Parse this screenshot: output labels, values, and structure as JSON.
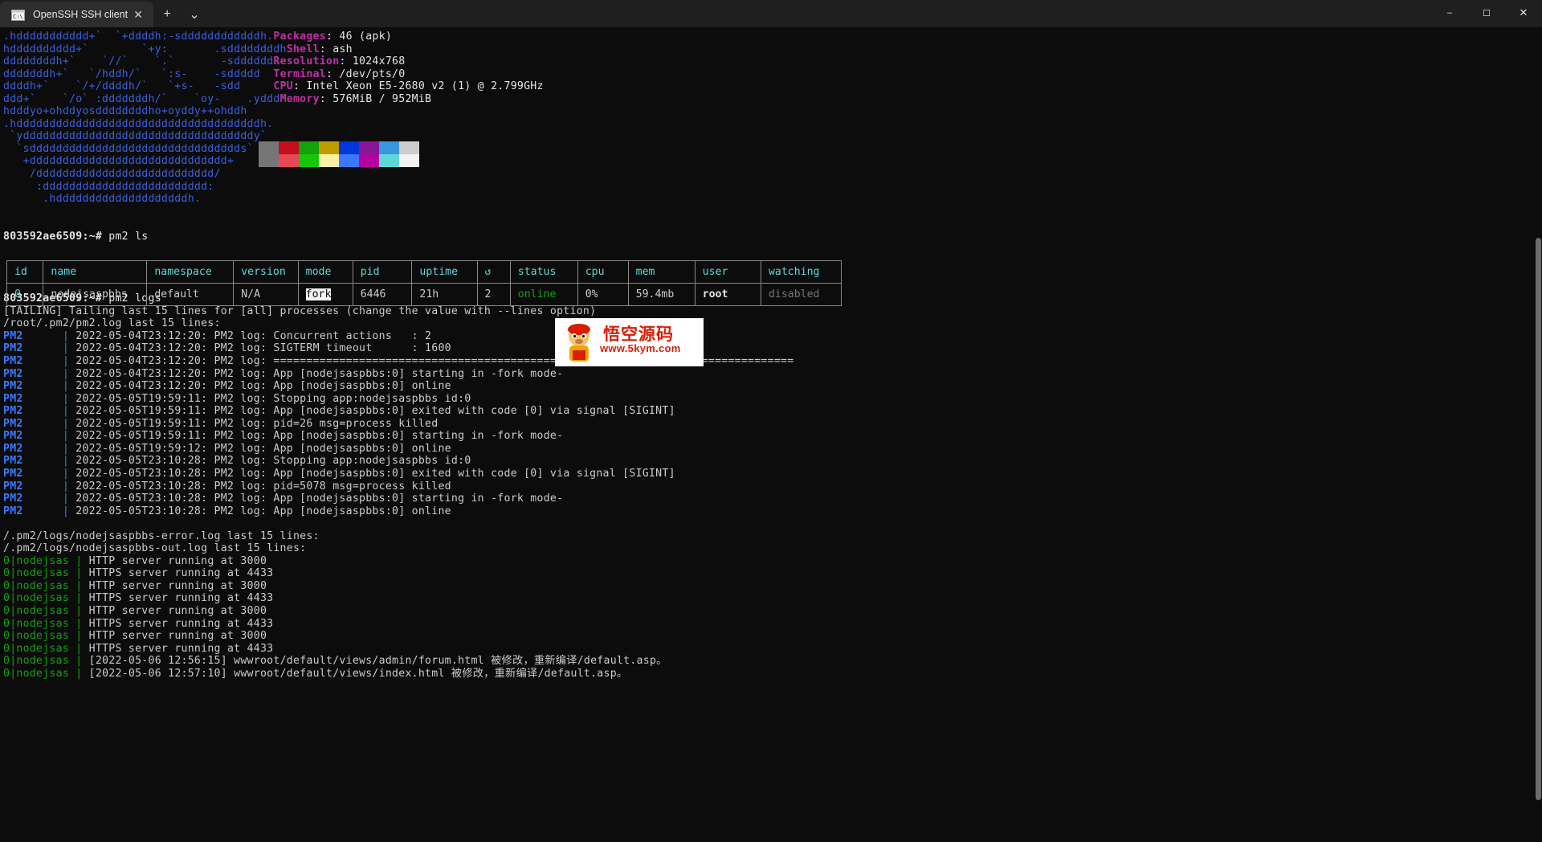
{
  "window": {
    "tab_title": "OpenSSH SSH client",
    "tab_icon": "terminal-icon",
    "close_glyph": "✕",
    "new_tab_glyph": "+",
    "dropdown_glyph": "⌄",
    "minimize_glyph": "–",
    "maximize_glyph": "☐",
    "window_close_glyph": "✕"
  },
  "neofetch": {
    "ascii": [
      ".hddddddddddd+`  `+ddddh:-sddddddddddddh.",
      "hdddddddddd+`        `+y:       .sddddddddh",
      "ddddddddh+`    `//`    `.`       -sdddddd",
      "dddddddh+`   `/hddh/`   `:s-    -sddddd",
      "ddddh+`    `/+/ddddh/`   `+s-   -sdd",
      "ddd+`    `/o` :dddddddh/`    `oy-    .yddd",
      "hdddyo+ohddyosddddddddho+oyddy++ohddh",
      ".hdddddddddddddddddddddddddddddddddddddh.",
      " `ydddddddddddddddddddddddddddddddddddy`",
      "  `sdddddddddddddddddddddddddddddddds`",
      "   +dddddddddddddddddddddddddddddd+",
      "    /ddddddddddddddddddddddddddd/",
      "     :ddddddddddddddddddddddddd:",
      "      .hddddddddddddddddddddh."
    ],
    "info": [
      {
        "label": "Packages",
        "value": "46 (apk)"
      },
      {
        "label": "Shell",
        "value": "ash"
      },
      {
        "label": "Resolution",
        "value": "1024x768"
      },
      {
        "label": "Terminal",
        "value": "/dev/pts/0"
      },
      {
        "label": "CPU",
        "value": "Intel Xeon E5-2680 v2 (1) @ 2.799GHz"
      },
      {
        "label": "Memory",
        "value": "576MiB / 952MiB"
      }
    ],
    "palette_row1": [
      "#767676",
      "#c50f1f",
      "#13a10e",
      "#c19c00",
      "#0037da",
      "#881798",
      "#3a96dd",
      "#cccccc"
    ],
    "palette_row2": [
      "#767676",
      "#e74856",
      "#16c60c",
      "#f9f1a5",
      "#3b78ff",
      "#b4009e",
      "#61d6d6",
      "#f2f2f2"
    ]
  },
  "prompt": "803592ae6509:~#",
  "commands": {
    "ls": "pm2 ls",
    "logs": "pm2 logs"
  },
  "pm2_table": {
    "headers": [
      "id",
      "name",
      "namespace",
      "version",
      "mode",
      "pid",
      "uptime",
      "↺",
      "status",
      "cpu",
      "mem",
      "user",
      "watching"
    ],
    "row": {
      "id": "0",
      "name": "nodejsaspbbs",
      "namespace": "default",
      "version": "N/A",
      "mode": "fork",
      "pid": "6446",
      "uptime": "21h",
      "restarts": "2",
      "status": "online",
      "cpu": "0%",
      "mem": "59.4mb",
      "user": "root",
      "watching": "disabled"
    }
  },
  "logs": {
    "tailing_notice": "[TAILING] Tailing last 15 lines for [all] processes (change the value with --lines option)",
    "pm2_log_header": "/root/.pm2/pm2.log last 15 lines:",
    "error_log_header": "/.pm2/logs/nodejsaspbbs-error.log last 15 lines:",
    "out_log_header": "/.pm2/logs/nodejsaspbbs-out.log last 15 lines:",
    "pm2_prefix": "PM2",
    "pm2_lines": [
      "2022-05-04T23:12:20: PM2 log: Concurrent actions   : 2",
      "2022-05-04T23:12:20: PM2 log: SIGTERM timeout      : 1600",
      "2022-05-04T23:12:20: PM2 log: ===============================================================================",
      "2022-05-04T23:12:20: PM2 log: App [nodejsaspbbs:0] starting in -fork mode-",
      "2022-05-04T23:12:20: PM2 log: App [nodejsaspbbs:0] online",
      "2022-05-05T19:59:11: PM2 log: Stopping app:nodejsaspbbs id:0",
      "2022-05-05T19:59:11: PM2 log: App [nodejsaspbbs:0] exited with code [0] via signal [SIGINT]",
      "2022-05-05T19:59:11: PM2 log: pid=26 msg=process killed",
      "2022-05-05T19:59:11: PM2 log: App [nodejsaspbbs:0] starting in -fork mode-",
      "2022-05-05T19:59:12: PM2 log: App [nodejsaspbbs:0] online",
      "2022-05-05T23:10:28: PM2 log: Stopping app:nodejsaspbbs id:0",
      "2022-05-05T23:10:28: PM2 log: App [nodejsaspbbs:0] exited with code [0] via signal [SIGINT]",
      "2022-05-05T23:10:28: PM2 log: pid=5078 msg=process killed",
      "2022-05-05T23:10:28: PM2 log: App [nodejsaspbbs:0] starting in -fork mode-",
      "2022-05-05T23:10:28: PM2 log: App [nodejsaspbbs:0] online"
    ],
    "app_prefix": "0|nodejsas",
    "app_lines": [
      "HTTP server running at 3000",
      "HTTPS server running at 4433",
      "HTTP server running at 3000",
      "HTTPS server running at 4433",
      "HTTP server running at 3000",
      "HTTPS server running at 4433",
      "HTTP server running at 3000",
      "HTTPS server running at 4433",
      "[2022-05-06 12:56:15] wwwroot/default/views/admin/forum.html 被修改，重新编译/default.asp。",
      "[2022-05-06 12:57:10] wwwroot/default/views/index.html 被修改，重新编译/default.asp。"
    ]
  },
  "watermark": {
    "cn_text": "悟空源码",
    "url_text": "www.5kym.com"
  }
}
